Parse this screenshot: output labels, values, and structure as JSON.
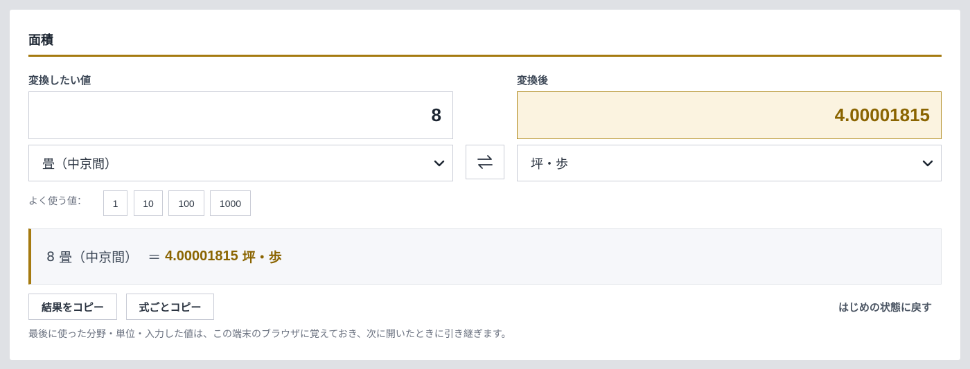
{
  "section": {
    "title": "面積"
  },
  "from": {
    "label": "変換したい値",
    "value": "8",
    "unit_selected": "畳（中京間）"
  },
  "to": {
    "label": "変換後",
    "value": "4.00001815",
    "unit_selected": "坪・歩"
  },
  "swap": {
    "icon": "swap-arrows-icon"
  },
  "frequent": {
    "label": "よく使う値：",
    "values": [
      "1",
      "10",
      "100",
      "1000"
    ]
  },
  "result": {
    "source_value": "8",
    "source_unit": "畳（中京間）",
    "equals": "＝",
    "value": "4.00001815",
    "unit": "坪・歩"
  },
  "actions": {
    "copy_result": "結果をコピー",
    "copy_formula": "式ごとコピー",
    "reset": "はじめの状態に戻す"
  },
  "note": "最後に使った分野・単位・入力した値は、この端末のブラウザに覚えておき、次に開いたときに引き継ぎます。",
  "colors": {
    "accent": "#a57a10",
    "result_text": "#8a6400",
    "result_bg": "#fbf3e0"
  }
}
